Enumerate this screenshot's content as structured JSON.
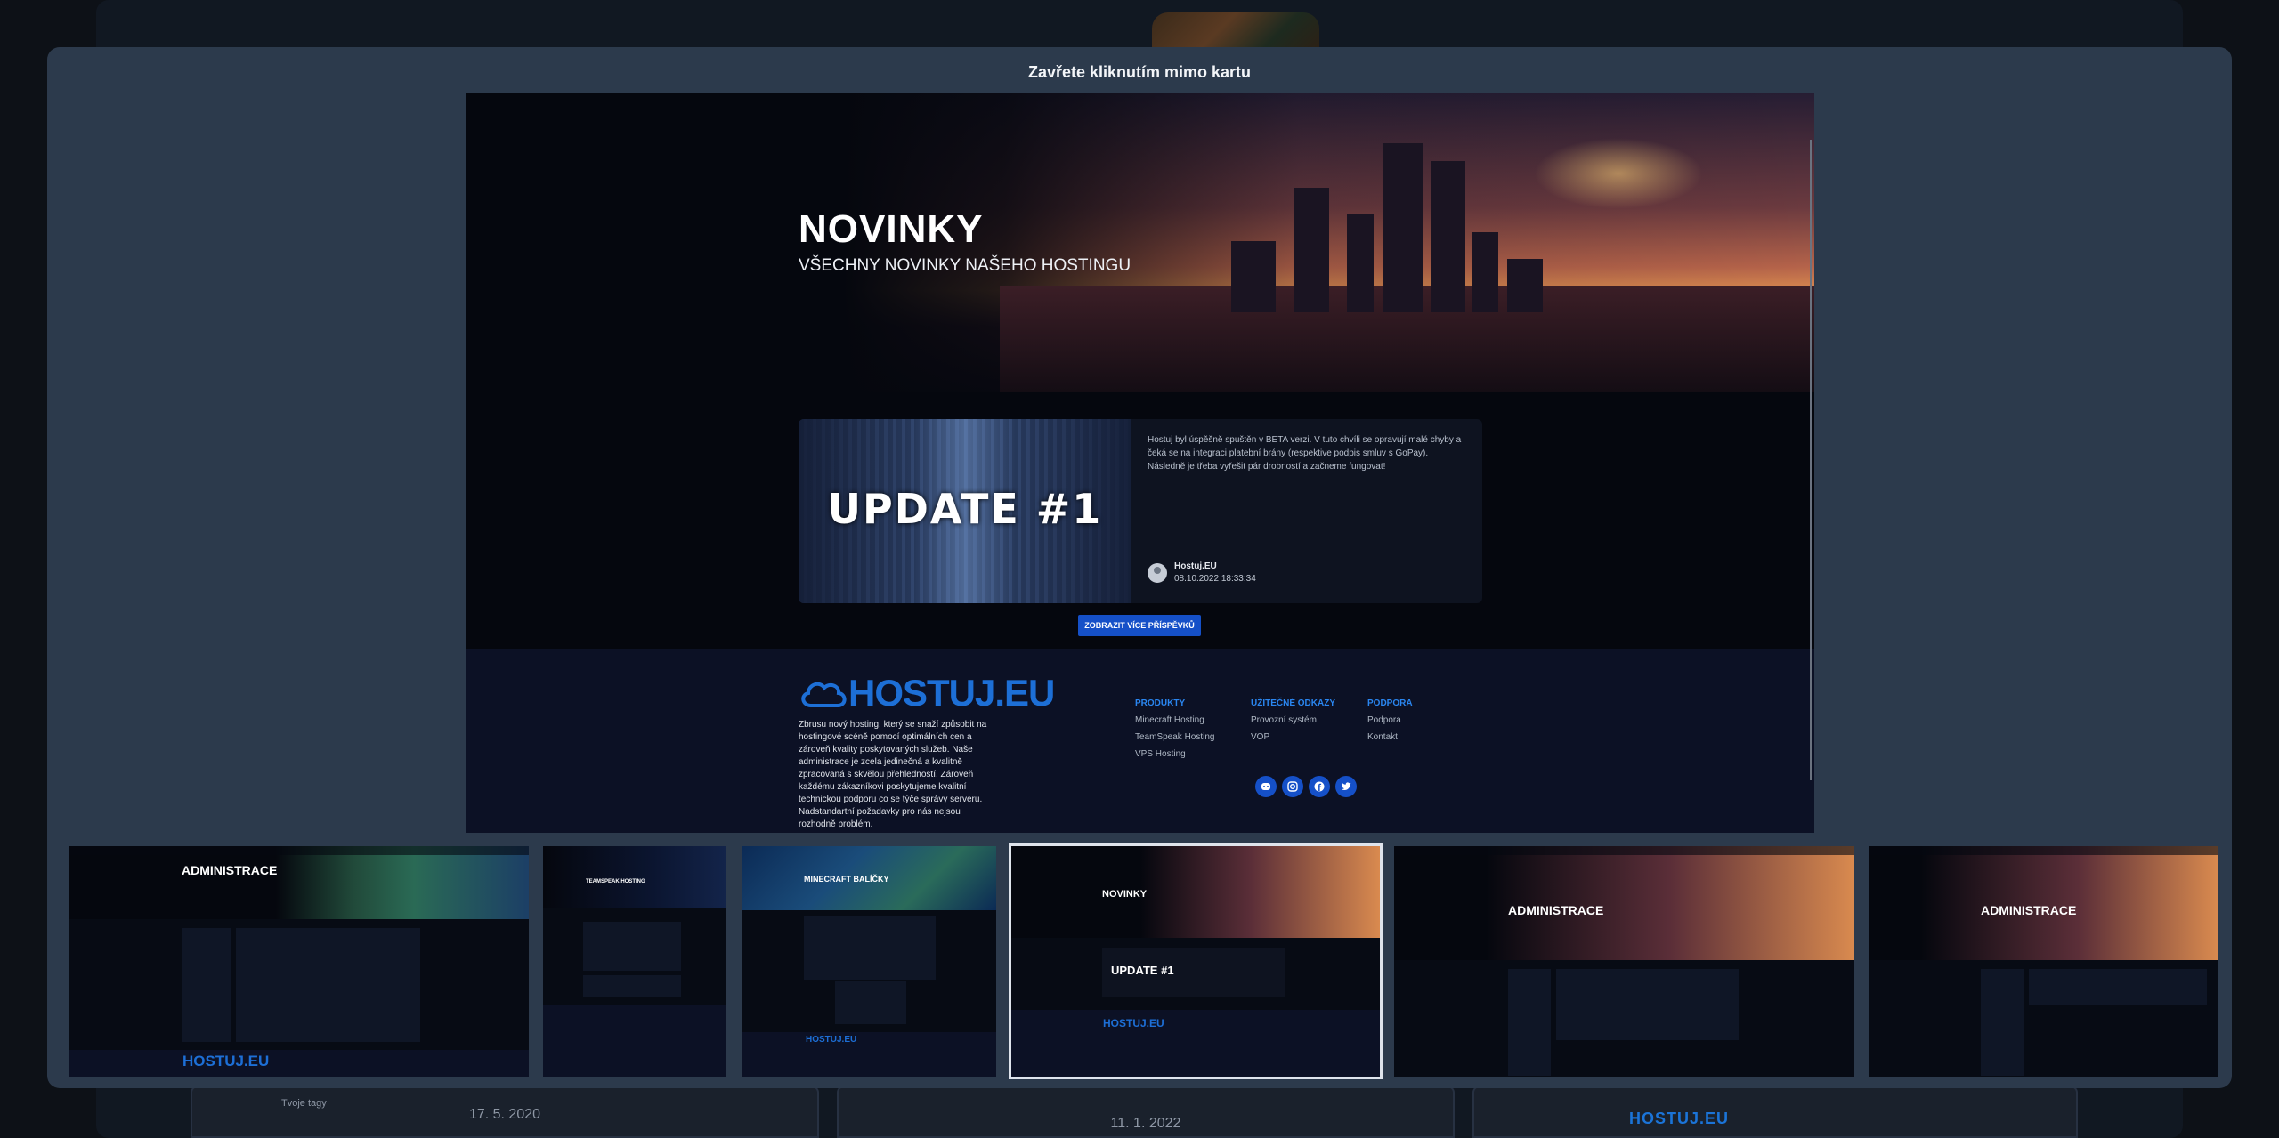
{
  "modal": {
    "hint": "Zavřete kliknutím mimo kartu"
  },
  "screenshot": {
    "hero": {
      "title": "NOVINKY",
      "subtitle": "VŠECHNY NOVINKY NAŠEHO HOSTINGU"
    },
    "post": {
      "image_label": "UPDATE #1",
      "text": "Hostuj byl úspěšně spuštěn v BETA verzi. V tuto chvíli se opravují malé chyby a čeká se na integraci platební brány (respektive podpis smluv s GoPay). Následně je třeba vyřešit pár drobností a začneme fungovat!",
      "author": "Hostuj.EU",
      "date": "08.10.2022 18:33:34"
    },
    "more_button": "ZOBRAZIT VÍCE PŘÍSPĚVKŮ",
    "footer": {
      "logo": "HOSTUJ.EU",
      "description": "Zbrusu nový hosting, který se snaží způsobit na hostingové scéně pomocí optimálních cen a zároveň kvality poskytovaných služeb. Naše administrace je zcela jedinečná a kvalitně zpracovaná s skvělou přehledností. Zároveň každému zákazníkovi poskytujeme kvalitní technickou podporu co se týče správy serveru. Nadstandartní požadavky pro nás nejsou rozhodně problém.",
      "columns": [
        {
          "title": "PRODUKTY",
          "links": [
            "Minecraft Hosting",
            "TeamSpeak Hosting",
            "VPS Hosting"
          ]
        },
        {
          "title": "UŽITEČNÉ ODKAZY",
          "links": [
            "Provozní systém",
            "VOP"
          ]
        },
        {
          "title": "PODPORA",
          "links": [
            "Podpora",
            "Kontakt"
          ]
        }
      ],
      "socials": [
        "discord-icon",
        "instagram-icon",
        "facebook-icon",
        "twitter-icon"
      ]
    }
  },
  "thumbnails": [
    {
      "title": "ADMINISTRACE",
      "logo": "HOSTUJ.EU",
      "active": false
    },
    {
      "title": "TEAMSPEAK HOSTING",
      "active": false
    },
    {
      "title": "MINECRAFT BALÍČKY",
      "logo": "HOSTUJ.EU",
      "active": false
    },
    {
      "title": "NOVINKY",
      "image_label": "UPDATE #1",
      "logo": "HOSTUJ.EU",
      "active": true
    },
    {
      "title": "ADMINISTRACE",
      "active": false
    },
    {
      "title": "ADMINISTRACE",
      "active": false
    }
  ],
  "background": {
    "tag_placeholder": "Tvoje tagy",
    "card_dates": [
      "17. 5. 2020",
      "11. 1. 2022"
    ],
    "mini_logo": "HOSTUJ.EU"
  },
  "colors": {
    "modal_bg": "#2c3a4c",
    "accent": "#1550c8",
    "link_heading": "#2a86f0",
    "logo": "#1d6fd6"
  }
}
